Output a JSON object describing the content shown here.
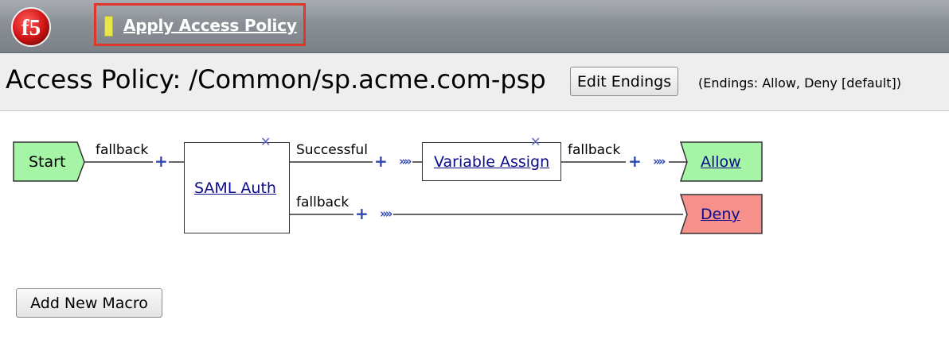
{
  "banner": {
    "logo_text": "f5",
    "apply_link": "Apply Access Policy",
    "marker_color": "#e8e64a",
    "highlight_color": "#e0362a"
  },
  "header": {
    "title": "Access Policy: /Common/sp.acme.com-psp",
    "edit_endings_label": "Edit Endings",
    "endings_note": "(Endings: Allow, Deny [default])"
  },
  "flow": {
    "start_label": "Start",
    "start_fallback": "fallback",
    "saml_label": "SAML Auth",
    "saml_successful": "Successful",
    "saml_fallback": "fallback",
    "variable_label": "Variable Assign",
    "variable_fallback": "fallback",
    "allow_label": "Allow",
    "deny_label": "Deny",
    "start_color": "#a6f5a6",
    "allow_color": "#a6f5a6",
    "deny_color": "#f6908a"
  },
  "footer": {
    "add_macro_label": "Add New Macro"
  }
}
